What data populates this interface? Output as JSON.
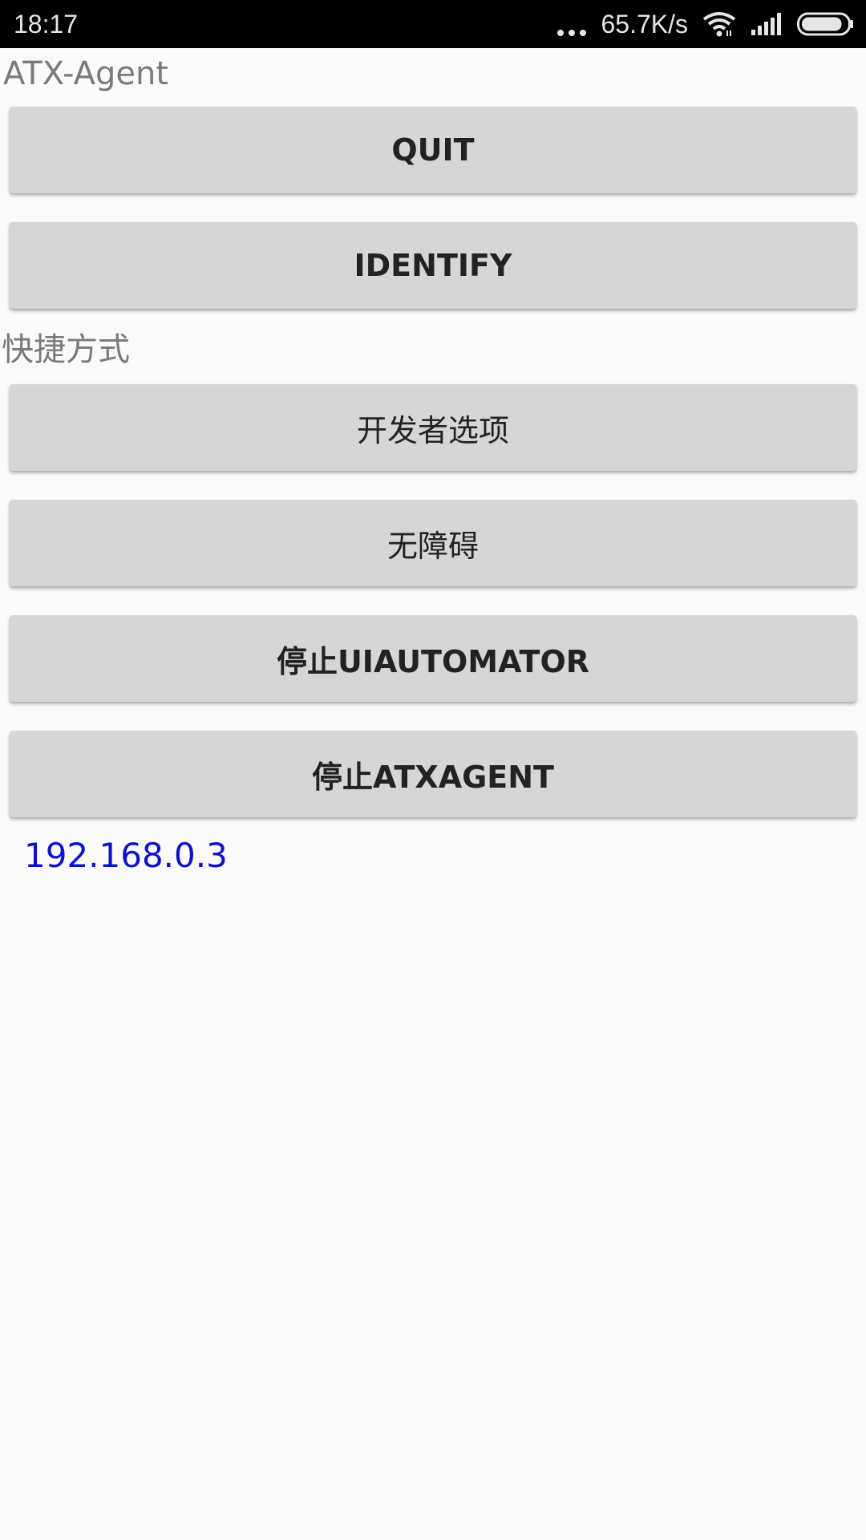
{
  "status_bar": {
    "time": "18:17",
    "more_icon": "more-dots-icon",
    "network_speed": "65.7K/s",
    "wifi_icon": "wifi-icon",
    "signal_icon": "cellular-signal-icon",
    "battery_icon": "battery-icon",
    "battery_level": 0.9
  },
  "app": {
    "title": "ATX-Agent"
  },
  "buttons_top": {
    "quit_label": "QUIT",
    "identify_label": "IDENTIFY"
  },
  "shortcuts": {
    "section_label": "快捷方式",
    "developer_options_label": "开发者选项",
    "accessibility_label": "无障碍",
    "stop_uiautomator_label": "停止UIAUTOMATOR",
    "stop_atxagent_label": "停止ATXAGENT"
  },
  "ip_address": "192.168.0.3",
  "colors": {
    "background": "#fafafa",
    "status_bar": "#000000",
    "button": "#d6d6d6",
    "label_gray": "#7a7a7a",
    "link_blue": "#1010c8"
  }
}
